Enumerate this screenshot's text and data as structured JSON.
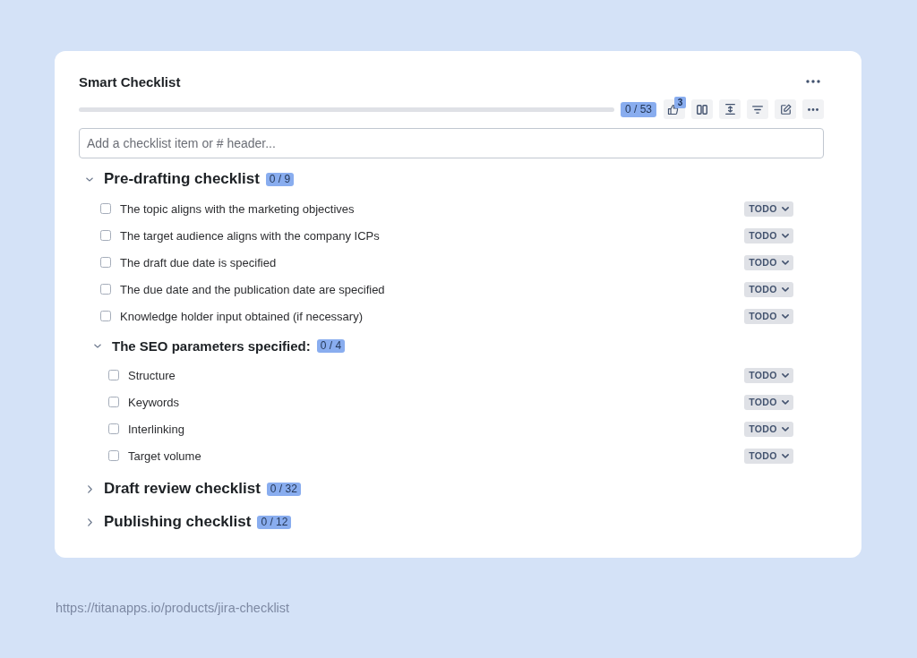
{
  "card": {
    "title": "Smart Checklist",
    "progress": {
      "level": 0,
      "count": "0 / 53"
    },
    "votes": {
      "count": "3"
    }
  },
  "input": {
    "placeholder": "Add a checklist item or # header..."
  },
  "sections": [
    {
      "kind": "header",
      "title": "Pre-drafting checklist",
      "count": "0 / 9",
      "expanded": true,
      "children": [
        {
          "kind": "item",
          "text": "The topic aligns with the marketing objectives",
          "checked": false,
          "status": "TODO"
        },
        {
          "kind": "item",
          "text": "The target audience aligns with the company ICPs",
          "checked": false,
          "status": "TODO"
        },
        {
          "kind": "item",
          "text": "The draft due date is specified",
          "checked": false,
          "status": "TODO"
        },
        {
          "kind": "item",
          "text": "The due date and the publication date are specified",
          "checked": false,
          "status": "TODO"
        },
        {
          "kind": "item",
          "text": "Knowledge holder input obtained (if necessary)",
          "checked": false,
          "status": "TODO"
        },
        {
          "kind": "header",
          "title": "The SEO parameters specified:",
          "count": "0 / 4",
          "expanded": true,
          "children": [
            {
              "kind": "item",
              "text": "Structure",
              "checked": false,
              "status": "TODO"
            },
            {
              "kind": "item",
              "text": "Keywords",
              "checked": false,
              "status": "TODO"
            },
            {
              "kind": "item",
              "text": "Interlinking",
              "checked": false,
              "status": "TODO"
            },
            {
              "kind": "item",
              "text": "Target volume",
              "checked": false,
              "status": "TODO"
            }
          ]
        }
      ]
    },
    {
      "kind": "header",
      "title": "Draft review checklist",
      "count": "0 / 32",
      "expanded": false
    },
    {
      "kind": "header",
      "title": "Publishing checklist",
      "count": "0 / 12",
      "expanded": false
    }
  ],
  "footer": {
    "url": "https://titanapps.io/products/jira-checklist"
  }
}
